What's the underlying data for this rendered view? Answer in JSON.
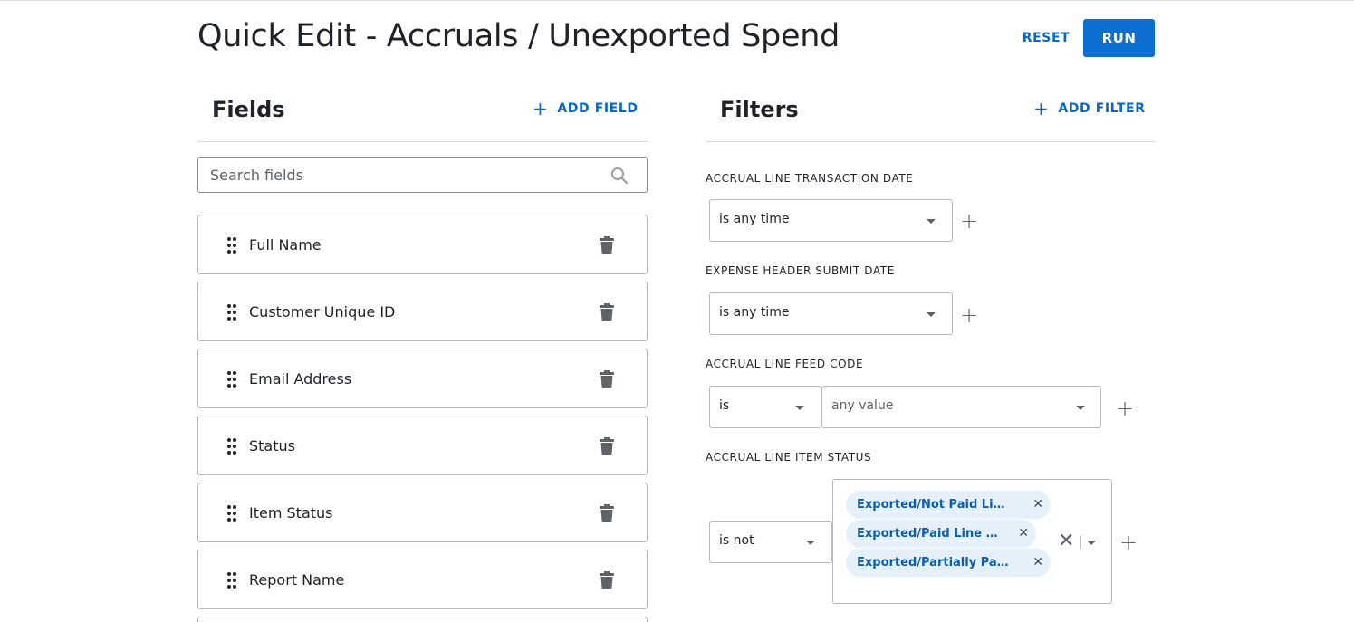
{
  "header": {
    "title": "Quick Edit - Accruals / Unexported Spend",
    "reset_label": "RESET",
    "run_label": "RUN"
  },
  "fields_panel": {
    "title": "Fields",
    "add_label": "ADD FIELD",
    "search_placeholder": "Search fields",
    "items": [
      {
        "label": "Full Name"
      },
      {
        "label": "Customer Unique ID"
      },
      {
        "label": "Email Address"
      },
      {
        "label": "Status"
      },
      {
        "label": "Item Status"
      },
      {
        "label": "Report Name"
      }
    ]
  },
  "filters_panel": {
    "title": "Filters",
    "add_label": "ADD FILTER",
    "filters": [
      {
        "label": "ACCRUAL LINE TRANSACTION DATE",
        "operator": "is any time"
      },
      {
        "label": "EXPENSE HEADER SUBMIT DATE",
        "operator": "is any time"
      },
      {
        "label": "ACCRUAL LINE FEED CODE",
        "operator": "is",
        "value_placeholder": "any value"
      },
      {
        "label": "ACCRUAL LINE ITEM STATUS",
        "operator": "is not",
        "tags": [
          "Exported/Not Paid Line I...",
          "Exported/Paid Line Item",
          "Exported/Partially Paid L..."
        ]
      }
    ]
  },
  "colors": {
    "accent": "#0b6fd1",
    "link": "#0b67c2",
    "tag_bg": "#e6f0fa"
  },
  "icons": {
    "add": "plus-icon",
    "search": "search-icon",
    "drag": "drag-handle-icon",
    "delete": "trash-icon",
    "dropdown": "chevron-down-icon",
    "remove": "close-icon"
  }
}
